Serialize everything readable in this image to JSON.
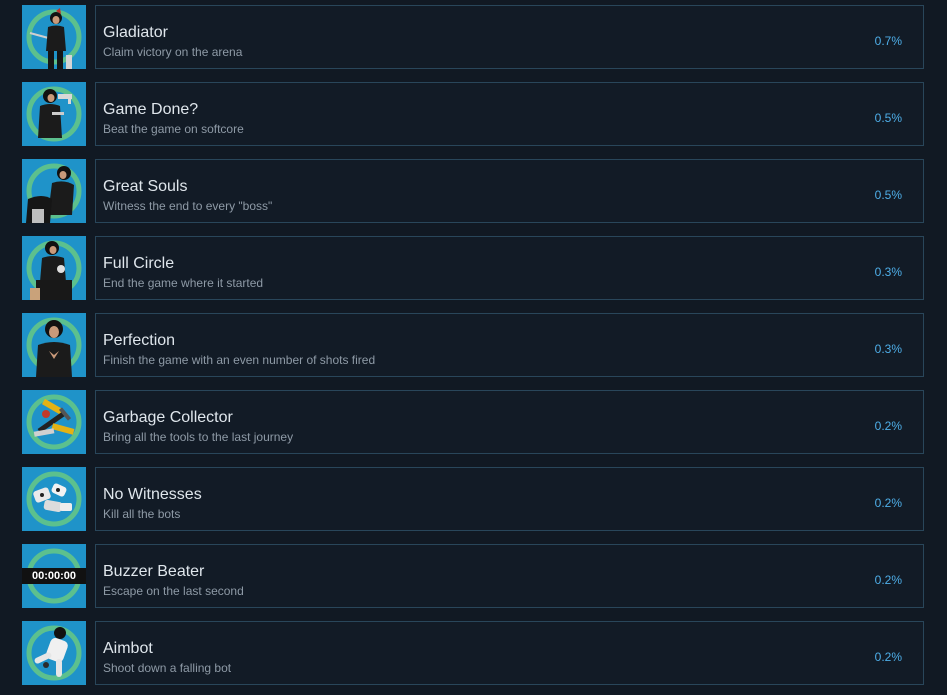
{
  "achievements": [
    {
      "name": "Gladiator",
      "description": "Claim victory on the arena",
      "percent": "0.7%",
      "icon": "woman-sword-icon"
    },
    {
      "name": "Game Done?",
      "description": "Beat the game on softcore",
      "percent": "0.5%",
      "icon": "woman-pistols-icon"
    },
    {
      "name": "Great Souls",
      "description": "Witness the end to every \"boss\"",
      "percent": "0.5%",
      "icon": "woman-boss-icon"
    },
    {
      "name": "Full Circle",
      "description": "End the game where it started",
      "percent": "0.3%",
      "icon": "woman-seated-icon"
    },
    {
      "name": "Perfection",
      "description": "Finish the game with an even number of shots fired",
      "percent": "0.3%",
      "icon": "woman-portrait-icon"
    },
    {
      "name": "Garbage Collector",
      "description": "Bring all the tools to the last journey",
      "percent": "0.2%",
      "icon": "tools-pile-icon"
    },
    {
      "name": "No Witnesses",
      "description": "Kill all the bots",
      "percent": "0.2%",
      "icon": "broken-bots-icon"
    },
    {
      "name": "Buzzer Beater",
      "description": "Escape on the last second",
      "percent": "0.2%",
      "icon": "timer-icon",
      "timer_text": "00:00:00"
    },
    {
      "name": "Aimbot",
      "description": "Shoot down a falling bot",
      "percent": "0.2%",
      "icon": "falling-bot-icon"
    }
  ],
  "colors": {
    "background": "#111923",
    "card_border": "#29465a",
    "icon_bg": "#1f93c9",
    "ring": "#5cc08e",
    "percent_text": "#4eaee8"
  }
}
